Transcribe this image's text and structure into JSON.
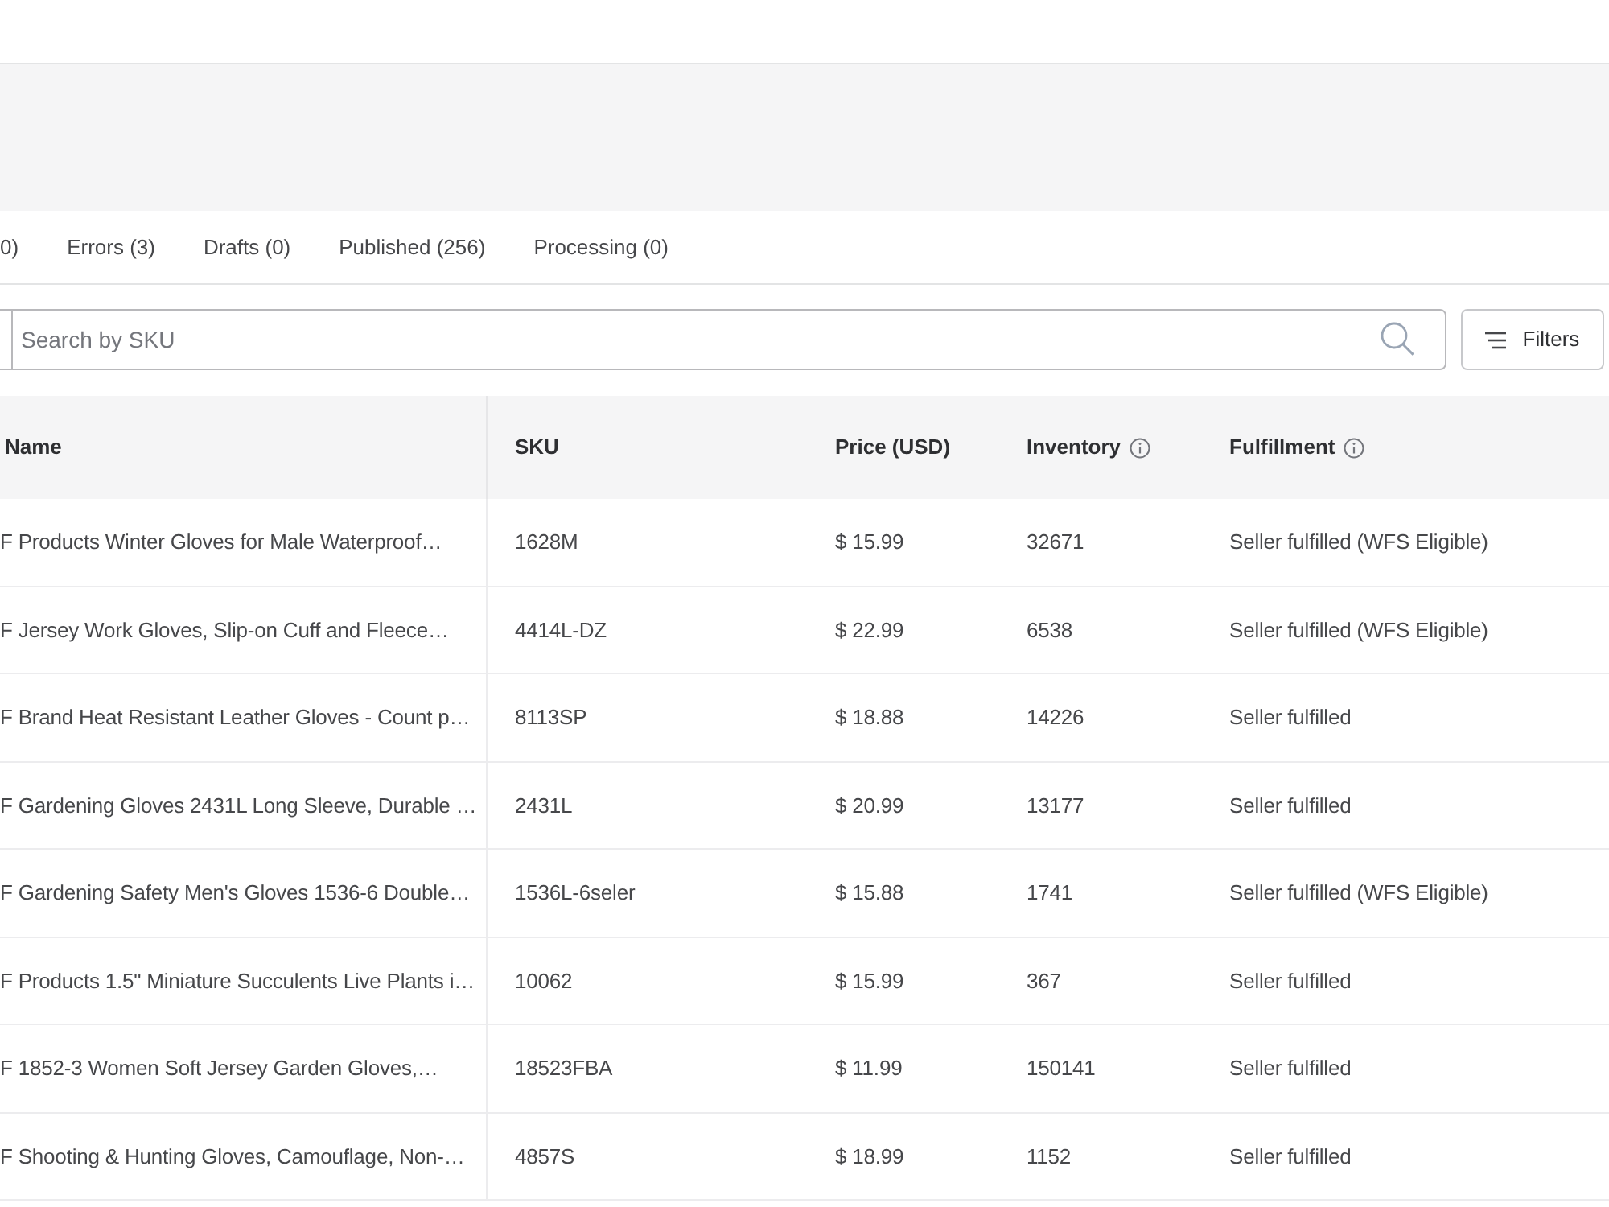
{
  "tabs": [
    {
      "label": "0)",
      "selected": false
    },
    {
      "label": "Errors (3)",
      "selected": false
    },
    {
      "label": "Drafts (0)",
      "selected": false
    },
    {
      "label": "Published (256)",
      "selected": false
    },
    {
      "label": "Processing (0)",
      "selected": false
    }
  ],
  "search": {
    "placeholder": "Search by SKU"
  },
  "filters_button": {
    "label": "Filters"
  },
  "table": {
    "columns": [
      {
        "label": "Name",
        "info": false
      },
      {
        "label": "SKU",
        "info": false
      },
      {
        "label": "Price (USD)",
        "info": false
      },
      {
        "label": "Inventory",
        "info": true
      },
      {
        "label": "Fulfillment",
        "info": true
      }
    ],
    "rows": [
      {
        "name": "F Products Winter Gloves for Male Waterproof…",
        "sku": "1628M",
        "price": "$ 15.99",
        "inventory": "32671",
        "fulfillment": "Seller fulfilled (WFS Eligible)"
      },
      {
        "name": "F Jersey Work Gloves, Slip-on Cuff and Fleece…",
        "sku": "4414L-DZ",
        "price": "$ 22.99",
        "inventory": "6538",
        "fulfillment": "Seller fulfilled (WFS Eligible)"
      },
      {
        "name": "F Brand Heat Resistant Leather Gloves - Count p…",
        "sku": "8113SP",
        "price": "$ 18.88",
        "inventory": "14226",
        "fulfillment": "Seller fulfilled"
      },
      {
        "name": "F Gardening Gloves 2431L Long Sleeve, Durable …",
        "sku": "2431L",
        "price": "$ 20.99",
        "inventory": "13177",
        "fulfillment": "Seller fulfilled"
      },
      {
        "name": "F Gardening Safety Men's Gloves 1536-6 Double…",
        "sku": "1536L-6seler",
        "price": "$ 15.88",
        "inventory": "1741",
        "fulfillment": "Seller fulfilled (WFS Eligible)"
      },
      {
        "name": "F Products 1.5\" Miniature Succulents Live Plants i…",
        "sku": "10062",
        "price": "$ 15.99",
        "inventory": "367",
        "fulfillment": "Seller fulfilled"
      },
      {
        "name": "F 1852-3 Women Soft Jersey Garden Gloves,…",
        "sku": "18523FBA",
        "price": "$ 11.99",
        "inventory": "150141",
        "fulfillment": "Seller fulfilled"
      },
      {
        "name": "F Shooting & Hunting Gloves, Camouflage, Non-…",
        "sku": "4857S",
        "price": "$ 18.99",
        "inventory": "1152",
        "fulfillment": "Seller fulfilled"
      }
    ]
  }
}
